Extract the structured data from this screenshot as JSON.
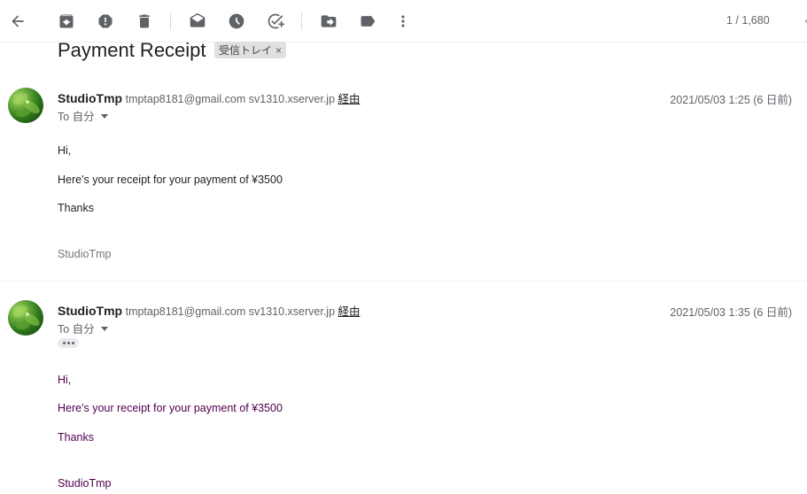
{
  "toolbar": {
    "pager_text": "1 / 1,680",
    "icons": [
      "back-arrow-icon",
      "archive-icon",
      "report-spam-icon",
      "delete-icon",
      "mark-unread-icon",
      "snooze-icon",
      "add-task-icon",
      "move-to-icon",
      "label-icon",
      "more-vert-icon",
      "chevron-left-icon"
    ]
  },
  "thread": {
    "subject": "Payment Receipt",
    "label": "受信トレイ",
    "label_close": "×"
  },
  "messages": [
    {
      "sender_name": "StudioTmp",
      "sender_email": "tmptap8181@gmail.com",
      "via_domain": "sv1310.xserver.jp",
      "via_label": "経由",
      "date": "2021/05/03 1:25 (6 日前)",
      "to": "To 自分",
      "greeting": "Hi,",
      "body": "Here's your receipt for your payment of ¥3500",
      "closing": "Thanks",
      "signature": "StudioTmp"
    },
    {
      "sender_name": "StudioTmp",
      "sender_email": "tmptap8181@gmail.com",
      "via_domain": "sv1310.xserver.jp",
      "via_label": "経由",
      "date": "2021/05/03 1:35 (6 日前)",
      "to": "To 自分",
      "greeting": "Hi,",
      "body": "Here's your receipt for your payment of ¥3500",
      "closing": "Thanks",
      "signature": "StudioTmp"
    }
  ],
  "colors": {
    "quoted_text": "#500050",
    "icon_gray": "#5f6368"
  }
}
